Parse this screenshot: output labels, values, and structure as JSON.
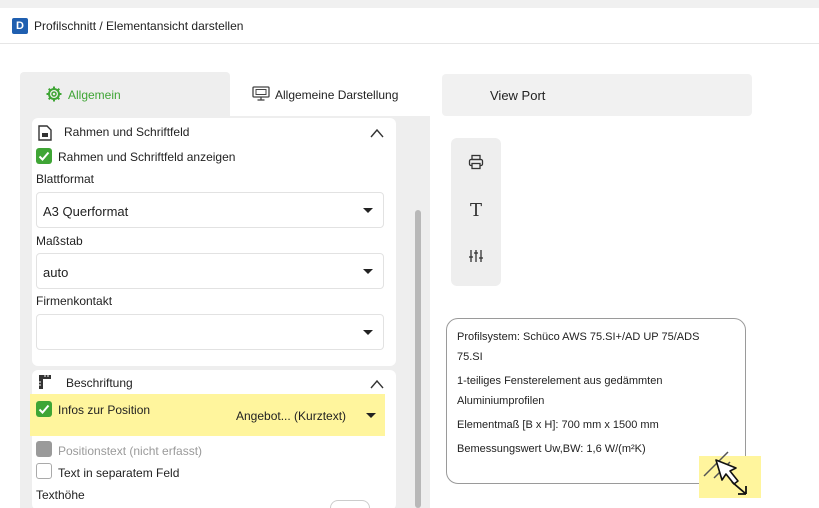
{
  "window": {
    "title": "Profilschnitt / Elementansicht darstellen",
    "app_icon_letter": "D"
  },
  "tabs": {
    "general": "Allgemein",
    "display": "Allgemeine Darstellung",
    "viewport": "View Port"
  },
  "frame_section": {
    "title": "Rahmen und Schriftfeld",
    "show_checkbox_label": "Rahmen und Schriftfeld anzeigen",
    "show_checked": true,
    "sheet_format_label": "Blattformat",
    "sheet_format_value": "A3 Querformat",
    "scale_label": "Maßstab",
    "scale_value": "auto",
    "company_label": "Firmenkontakt",
    "company_value": ""
  },
  "labeling_section": {
    "title": "Beschriftung",
    "position_info_label": "Infos zur Position",
    "position_info_checked": true,
    "position_info_dropdown": "Angebot... (Kurztext)",
    "position_text_label": "Positionstext (nicht erfasst)",
    "separate_field_label": "Text in separatem Feld",
    "text_height_label": "Texthöhe"
  },
  "toolbar": {
    "print_icon": "printer-icon",
    "text_icon_glyph": "T",
    "adjust_icon": "sliders-icon"
  },
  "info_box": {
    "line1": "Profilsystem: Schüco AWS 75.SI+/AD UP 75/ADS",
    "line2": "75.SI",
    "line3": "1-teiliges Fensterelement aus gedämmten",
    "line4": "Aluminiumprofilen",
    "line5": "Elementmaß [B x H]: 700 mm x 1500 mm",
    "line6": "Bemessungswert Uw,BW: 1,6 W/(m²K)"
  },
  "colors": {
    "accent_green": "#3fa535",
    "highlight_yellow": "#fff59d",
    "brand_blue": "#1f5fb0"
  }
}
